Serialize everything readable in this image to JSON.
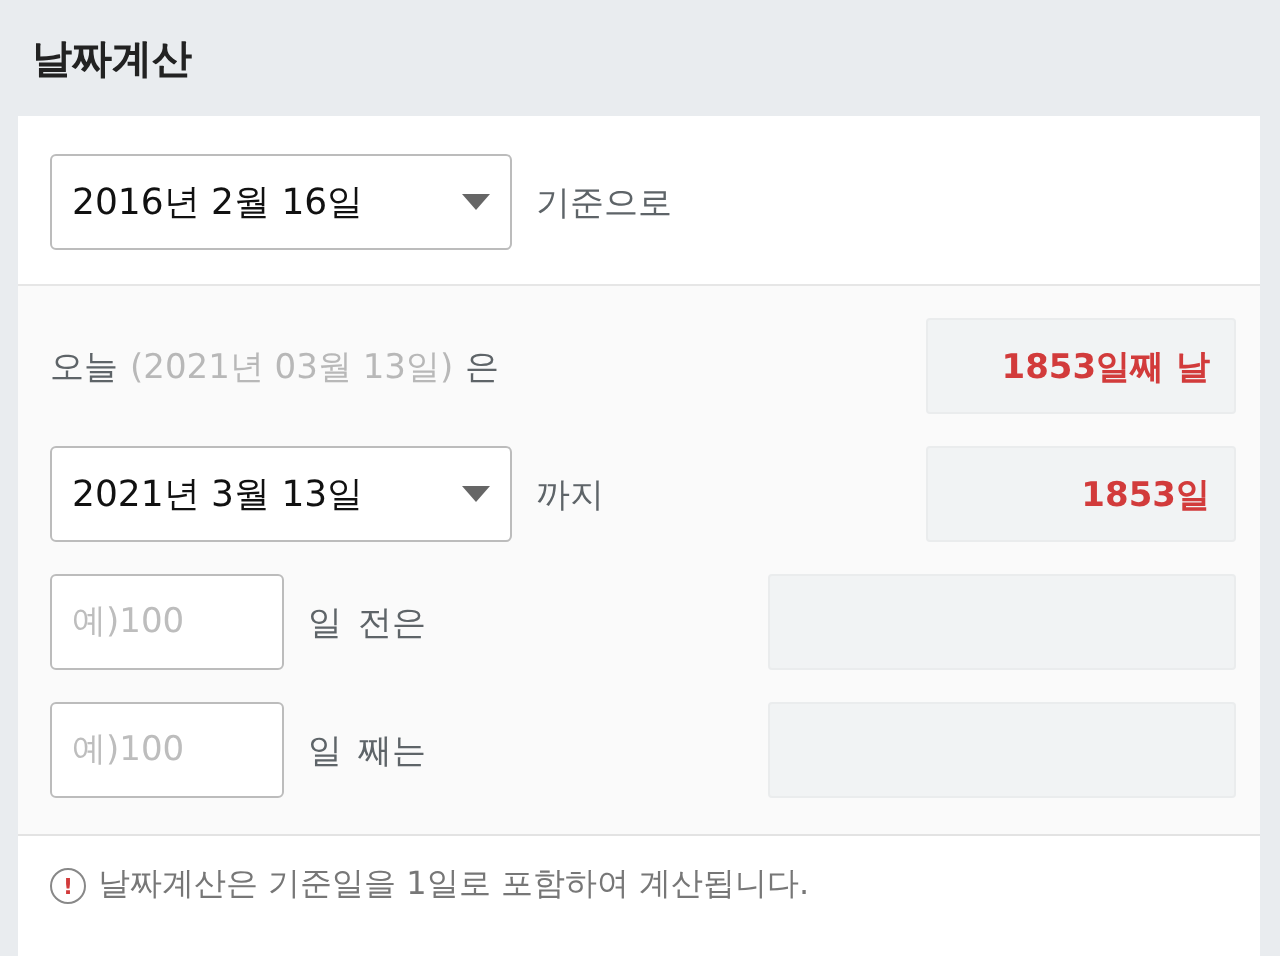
{
  "title": "날짜계산",
  "base": {
    "date": "2016년 2월 16일",
    "suffix": "기준으로"
  },
  "today": {
    "label": "오늘",
    "date": "(2021년 03월 13일)",
    "suffix": "은",
    "result": "1853일째 날"
  },
  "until": {
    "date": "2021년 3월 13일",
    "suffix": "까지",
    "result": "1853일"
  },
  "offsets": [
    {
      "placeholder": "예)100",
      "unit": "일",
      "suffix": "전은"
    },
    {
      "placeholder": "예)100",
      "unit": "일",
      "suffix": "째는"
    }
  ],
  "note": {
    "icon": "!",
    "text": "날짜계산은 기준일을 1일로 포함하여 계산됩니다."
  }
}
